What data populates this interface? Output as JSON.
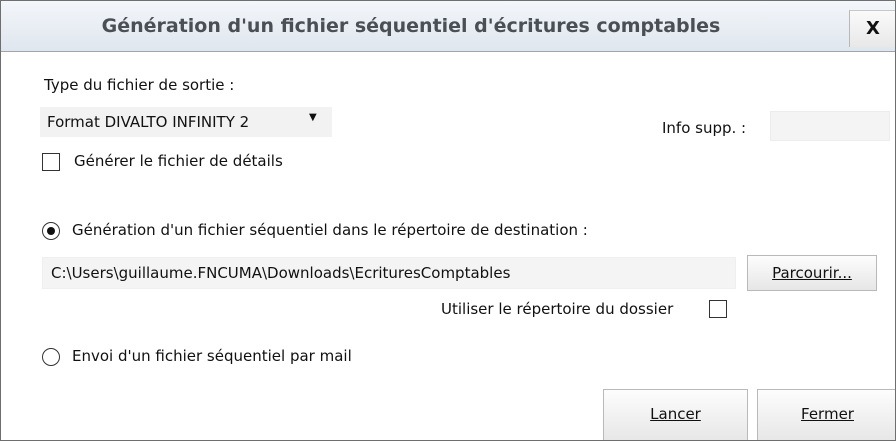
{
  "dialog": {
    "title": "Génération d'un fichier séquentiel d'écritures comptables",
    "close_label": "X"
  },
  "output_type": {
    "label": "Type du fichier de sortie :",
    "selected": "Format DIVALTO INFINITY 2",
    "arrow": "▼"
  },
  "info_supp": {
    "label": "Info supp. :",
    "value": ""
  },
  "details_checkbox": {
    "label": "Générer le fichier de détails",
    "checked": false
  },
  "destination_option": {
    "label": "Génération d'un fichier séquentiel dans le répertoire de destination :",
    "selected": true
  },
  "path": {
    "value": "C:\\Users\\guillaume.FNCUMA\\Downloads\\EcrituresComptables"
  },
  "browse_button": {
    "label": "Parcourir..."
  },
  "use_folder_checkbox": {
    "label": "Utiliser le répertoire du dossier",
    "checked": false
  },
  "mail_option": {
    "label": "Envoi d'un fichier séquentiel par mail",
    "selected": false
  },
  "buttons": {
    "launch": "Lancer",
    "close": "Fermer"
  }
}
